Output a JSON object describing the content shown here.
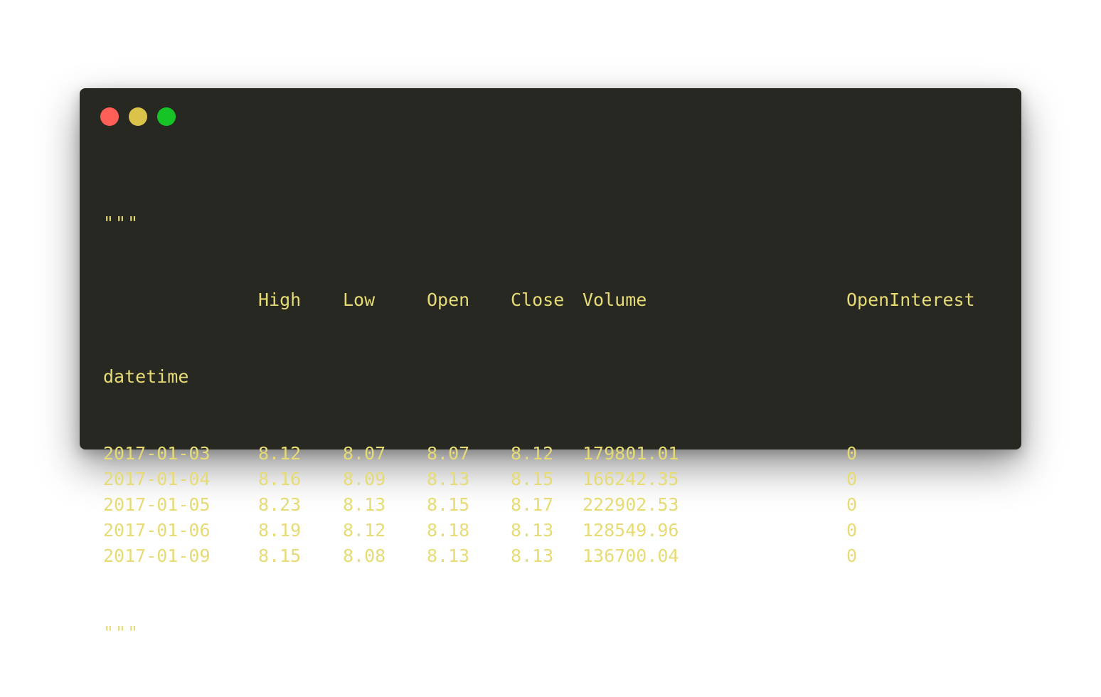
{
  "window": {
    "buttons": {
      "close_color": "#ff5f56",
      "minimize_color": "#dbc24b",
      "maximize_color": "#17c425"
    },
    "text_color": "#e6db74",
    "background_color": "#282823"
  },
  "code": {
    "open_quote": "\"\"\"",
    "close_quote": "\"\"\"",
    "index_name": "datetime",
    "headers": [
      "High",
      "Low",
      "Open",
      "Close",
      "Volume",
      "OpenInterest"
    ],
    "rows": [
      {
        "datetime": "2017-01-03",
        "high": "8.12",
        "low": "8.07",
        "open": "8.07",
        "close": "8.12",
        "volume": "179801.01",
        "openinterest": "0"
      },
      {
        "datetime": "2017-01-04",
        "high": "8.16",
        "low": "8.09",
        "open": "8.13",
        "close": "8.15",
        "volume": "166242.35",
        "openinterest": "0"
      },
      {
        "datetime": "2017-01-05",
        "high": "8.23",
        "low": "8.13",
        "open": "8.15",
        "close": "8.17",
        "volume": "222902.53",
        "openinterest": "0"
      },
      {
        "datetime": "2017-01-06",
        "high": "8.19",
        "low": "8.12",
        "open": "8.18",
        "close": "8.13",
        "volume": "128549.96",
        "openinterest": "0"
      },
      {
        "datetime": "2017-01-09",
        "high": "8.15",
        "low": "8.08",
        "open": "8.13",
        "close": "8.13",
        "volume": "136700.04",
        "openinterest": "0"
      }
    ]
  }
}
